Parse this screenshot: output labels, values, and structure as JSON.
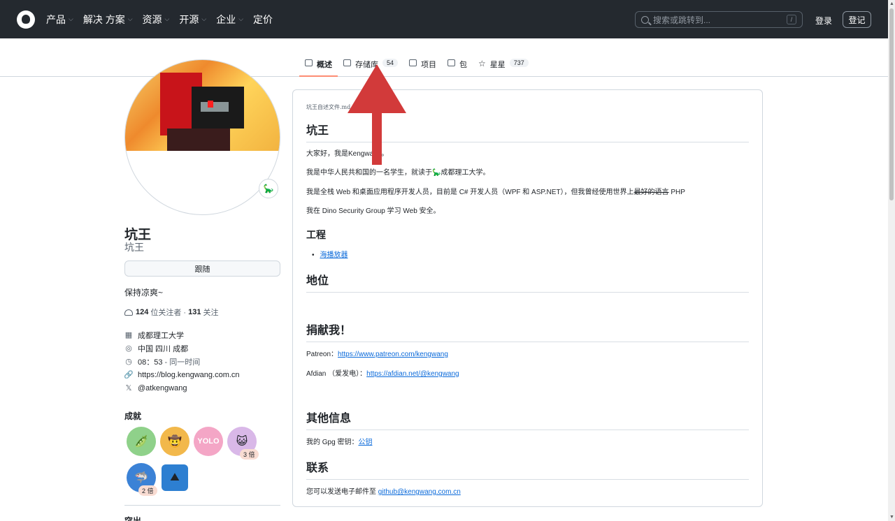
{
  "header": {
    "nav": [
      "产品",
      "解决 方案",
      "资源",
      "开源",
      "企业",
      "定价"
    ],
    "nav_has_dropdown": [
      true,
      true,
      true,
      true,
      true,
      false
    ],
    "search_placeholder": "搜索或跳转到...",
    "search_shortcut": "/",
    "login": "登录",
    "signup": "登记"
  },
  "tabs": [
    {
      "label": "概述",
      "icon": "book-icon",
      "active": true
    },
    {
      "label": "存储库",
      "icon": "repo-icon",
      "count": "54"
    },
    {
      "label": "项目",
      "icon": "table-icon"
    },
    {
      "label": "包",
      "icon": "package-icon"
    },
    {
      "label": "星星",
      "icon": "star-icon",
      "count": "737"
    }
  ],
  "profile": {
    "name": "坑王",
    "login": "坑王",
    "follow_label": "跟随",
    "bio": "保持凉爽~",
    "followers_count": "124",
    "followers_label": "位关注者 ·",
    "following_count": "131",
    "following_label": "关注",
    "org": "成都理工大学",
    "location": "中国 四川 成都",
    "time": "08：53",
    "time_suffix": "- 同一时间",
    "website": "https://blog.kengwang.com.cn",
    "twitter": "@atkengwang"
  },
  "achievements": {
    "title": "成就",
    "items": [
      {
        "icon": "pea-pod-icon",
        "color": "#8fd18a"
      },
      {
        "icon": "cowboy-icon",
        "color": "#f2b84b"
      },
      {
        "icon": "yolo-icon",
        "color": "#f4a6c6"
      },
      {
        "icon": "quickdraw-icon",
        "color": "#d9b8e8",
        "badge": "3 倍"
      },
      {
        "icon": "shark-icon",
        "color": "#3b82d6",
        "badge": "2 倍"
      },
      {
        "icon": "arctic-icon",
        "color": "#2d7fd1"
      }
    ]
  },
  "next_section": "突出",
  "readme": {
    "path": "坑王自述文件.md",
    "title": "坑王",
    "p1": "大家好，我是Kengwang。",
    "p2_a": "我是中华人民共和国的一名学生，就读于",
    "p2_b": "成都理工大学。",
    "p3_a": "我是全栈 Web 和桌面应用程序开发人员，目前是 C# 开发人员（WPF 和 ASP.NET），但我曾经使用世界上",
    "p3_strike": "最好的语言",
    "p3_b": " PHP",
    "p4": "我在 Dino Security Group 学习 Web 安全。",
    "h_projects": "工程",
    "project_link": "海播放器",
    "h_status": "地位",
    "h_donate": "捐献我！",
    "patreon_label": "Patreon：",
    "patreon_url": "https://www.patreon.com/kengwang",
    "afdian_label": "Afdian （爱发电）：",
    "afdian_url": "https://afdian.net/@kengwang",
    "h_other": "其他信息",
    "gpg_label": "我的 Gpg 密钥：",
    "gpg_link": "公钥",
    "h_contact": "联系",
    "contact_label": "您可以发送电子邮件至 ",
    "contact_email": "github@kengwang.com.cn"
  },
  "colors": {
    "header_bg": "#24292f",
    "active_tab": "#fd8c73",
    "link": "#0969da",
    "arrow": "#d23a3a"
  }
}
